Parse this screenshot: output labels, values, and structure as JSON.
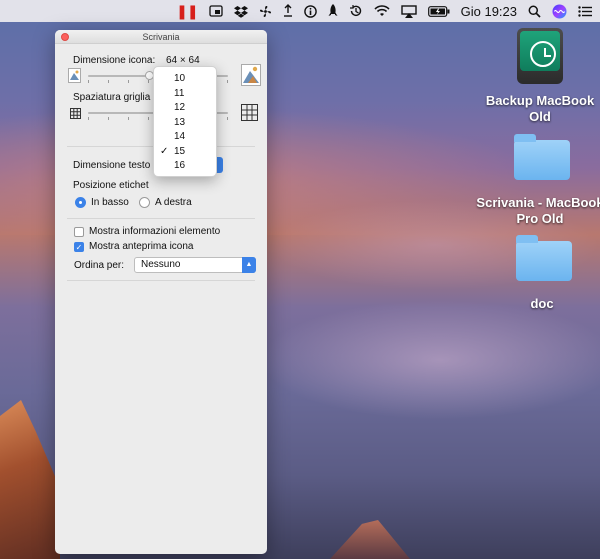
{
  "menubar": {
    "icons": [
      "pause-icon",
      "screen-capture-icon",
      "dropbox-icon",
      "fan-icon",
      "share-icon",
      "info-icon",
      "rocket-icon",
      "time-machine-icon",
      "wifi-icon",
      "airplay-icon",
      "battery-icon",
      "search-icon",
      "siri-icon",
      "menu-list-icon"
    ],
    "clock": "Gio 19:23"
  },
  "window": {
    "title": "Scrivania",
    "icon_size_label": "Dimensione icona:",
    "icon_size_value": "64 × 64",
    "grid_spacing_label": "Spaziatura griglia",
    "text_size_label": "Dimensione testo",
    "label_position_label": "Posizione etichet",
    "radio_bottom": "In basso",
    "radio_right": "A destra",
    "check_info": "Mostra informazioni elemento",
    "check_preview": "Mostra anteprima icona",
    "sort_label": "Ordina per:",
    "sort_value": "Nessuno"
  },
  "popup": {
    "items": [
      "10",
      "11",
      "12",
      "13",
      "14",
      "15",
      "16"
    ],
    "selected": "15"
  },
  "desktop": {
    "backup": "Backup MacBook Old",
    "scrivania": "Scrivania - MacBook Pro Old",
    "doc": "doc"
  },
  "colors": {
    "accent": "#3b82e8",
    "close": "#fc605c",
    "pause": "#d8201c"
  }
}
